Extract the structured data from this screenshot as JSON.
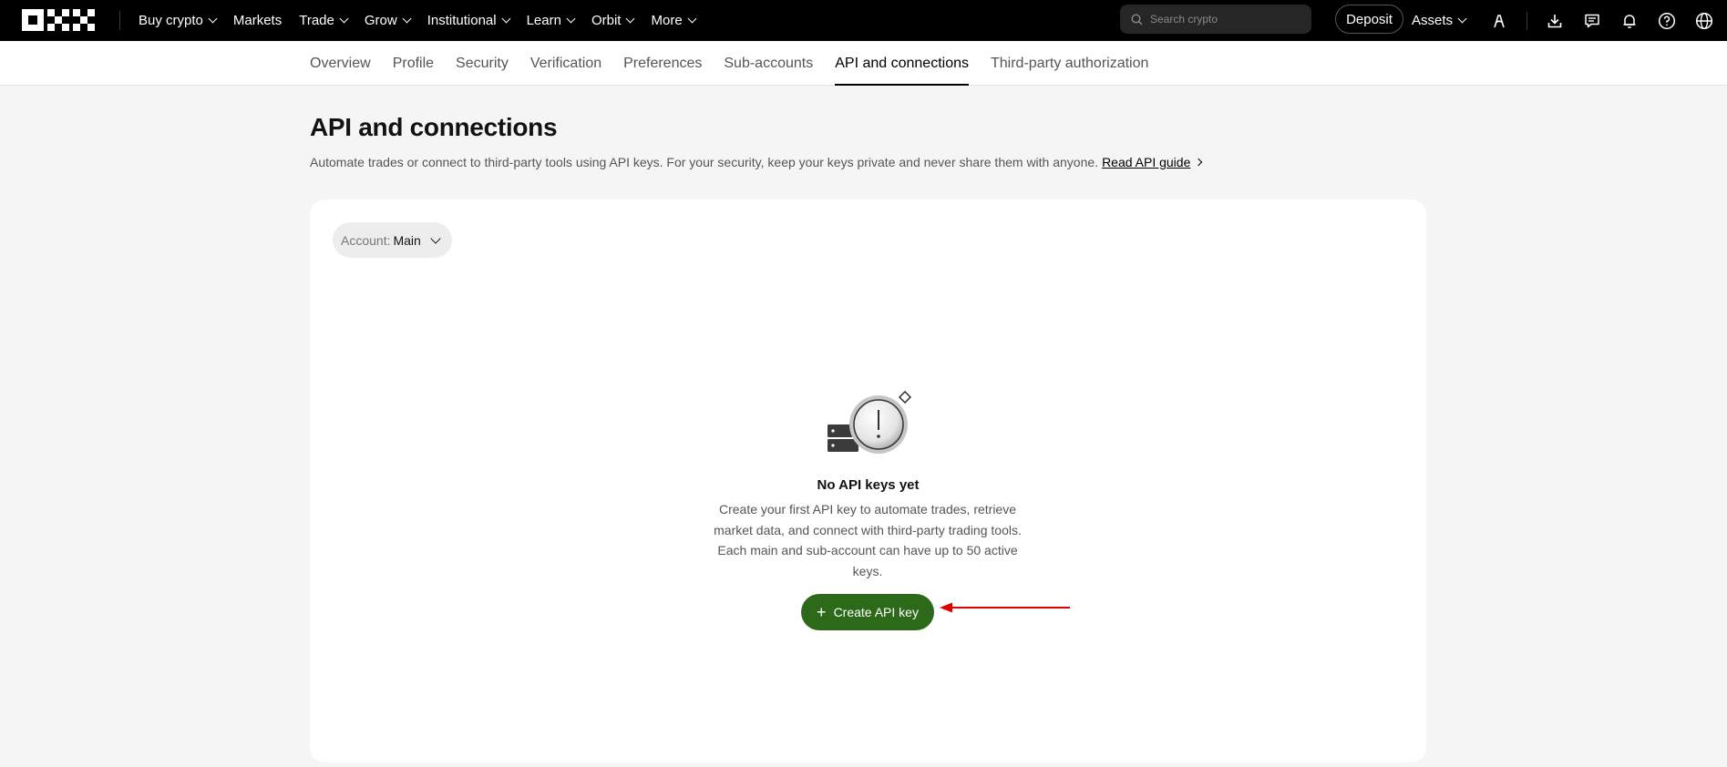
{
  "topnav": {
    "items": [
      {
        "label": "Buy crypto",
        "dropdown": true
      },
      {
        "label": "Markets",
        "dropdown": false
      },
      {
        "label": "Trade",
        "dropdown": true
      },
      {
        "label": "Grow",
        "dropdown": true
      },
      {
        "label": "Institutional",
        "dropdown": true
      },
      {
        "label": "Learn",
        "dropdown": true
      },
      {
        "label": "Orbit",
        "dropdown": true
      },
      {
        "label": "More",
        "dropdown": true
      }
    ],
    "search_placeholder": "Search crypto",
    "deposit_label": "Deposit",
    "assets_label": "Assets",
    "icons": [
      "user-icon",
      "download-icon",
      "chat-icon",
      "bell-icon",
      "help-icon",
      "globe-icon"
    ]
  },
  "subnav": {
    "tabs": [
      {
        "label": "Overview",
        "active": false
      },
      {
        "label": "Profile",
        "active": false
      },
      {
        "label": "Security",
        "active": false
      },
      {
        "label": "Verification",
        "active": false
      },
      {
        "label": "Preferences",
        "active": false
      },
      {
        "label": "Sub-accounts",
        "active": false
      },
      {
        "label": "API and connections",
        "active": true
      },
      {
        "label": "Third-party authorization",
        "active": false
      }
    ]
  },
  "page": {
    "title": "API and connections",
    "description": "Automate trades or connect to third-party tools using API keys. For your security, keep your keys private and never share them with anyone.",
    "guide_link": "Read API guide"
  },
  "card": {
    "account_label": "Account:",
    "account_value": "Main",
    "empty_title": "No API keys yet",
    "empty_desc": "Create your first API key to automate trades, retrieve market data, and connect with third-party trading tools. Each main and sub-account can have up to 50 active keys.",
    "create_button": "Create API key"
  },
  "colors": {
    "topbar": "#000000",
    "accent_green": "#2c6a19",
    "annotation_arrow": "#e00000"
  }
}
